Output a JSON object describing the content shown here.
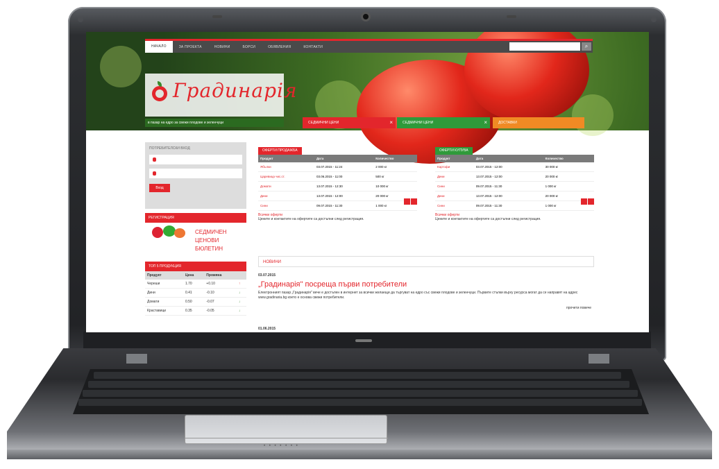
{
  "site": {
    "nav": [
      "НАЧАЛО",
      "ЗА ПРОЕКТА",
      "НОВИНИ",
      "БОРСИ",
      "ОБЯВЛЕНИЯ",
      "КОНТАКТИ"
    ],
    "logo_text": "Градинарія",
    "tagline": "в пазар на едро за свежи плодове и зеленчуци",
    "hero_tabs": [
      {
        "label": "СЕДМИЧНИ ЦЕНИ",
        "color": "#e3262c"
      },
      {
        "label": "СЕДМИЧНИ ЦЕНИ",
        "color": "#2f9a3a"
      },
      {
        "label": "ДОСТАВКИ",
        "color": "#f08a24"
      }
    ]
  },
  "sidebar": {
    "login_title": "ПОТРЕБИТЕЛСКИ ВХОД",
    "login_button": "Вход",
    "registration_title": "РЕГИСТРАЦИЯ",
    "promo_text": [
      "СЕДМИЧЕН",
      "ЦЕНОВИ",
      "БЮЛЕТИН"
    ],
    "top_title": "ТОП 5 ПРОДУКЦИЯ",
    "top_headers": [
      "Продукт",
      "Цена",
      "Промяна"
    ],
    "top_rows": [
      {
        "name": "Череши",
        "price": "1.70",
        "change": "+0.10",
        "dir": "up"
      },
      {
        "name": "Дини",
        "price": "0.41",
        "change": "-0.10",
        "dir": "down"
      },
      {
        "name": "Домати",
        "price": "0.50",
        "change": "-0.07",
        "dir": "down"
      },
      {
        "name": "Краставици",
        "price": "0.35",
        "change": "-0.05",
        "dir": "down"
      }
    ]
  },
  "panels": [
    {
      "caption": "ОФЕРТИ ПРОДАЖБА",
      "color": "#e3262c",
      "headers": [
        "Продукт",
        "Дата",
        "Количество"
      ],
      "rows": [
        [
          "Ябълки",
          "03.07.2015 - 11:24",
          "2 000 кг"
        ],
        [
          "Царевица чис.ст.",
          "03.06.2015 - 11:00",
          "500 кг"
        ],
        [
          "Домати",
          "13.07.2015 - 12:30",
          "10 000 кг"
        ],
        [
          "Дини",
          "13.07.2015 - 12:00",
          "20 000 кг"
        ],
        [
          "Сини",
          "09.07.2015 - 11:30",
          "1 000 кг"
        ]
      ],
      "more": "Всички оферти",
      "note": "Цените и контактите на офертите са достъпни след регистрация."
    },
    {
      "caption": "ОФЕРТИ КУПУВА",
      "color": "#2f9a3a",
      "headers": [
        "Продукт",
        "Дата",
        "Количество"
      ],
      "rows": [
        [
          "Картофи",
          "03.07.2015 - 12:00",
          "30 000 кг"
        ],
        [
          "Дини",
          "13.07.2015 - 12:00",
          "20 000 кг"
        ],
        [
          "Сини",
          "09.07.2015 - 11:30",
          "1 000 кг"
        ],
        [
          "Дини",
          "13.07.2015 - 12:00",
          "20 000 кг"
        ],
        [
          "Сини",
          "09.07.2015 - 11:30",
          "1 000 кг"
        ]
      ],
      "more": "Всички оферти",
      "note": "Цените и контактите на офертите са достъпни след регистрация."
    }
  ],
  "news": {
    "header": "НОВИНИ",
    "date": "03.07.2015",
    "title": "„Градинарія\" посреща първи потребители",
    "body": "Електронният пазар „Градинарія\" вече е достъпен в интернет за всички желаещи да търгуват на едро със свежи плодове и зеленчуци. Първите стъпки върху ресурса могат да се направят на адрес www.gradinaria.bg което е основа свежи потребители.",
    "more": "прочети повече",
    "date2": "01.06.2015"
  }
}
